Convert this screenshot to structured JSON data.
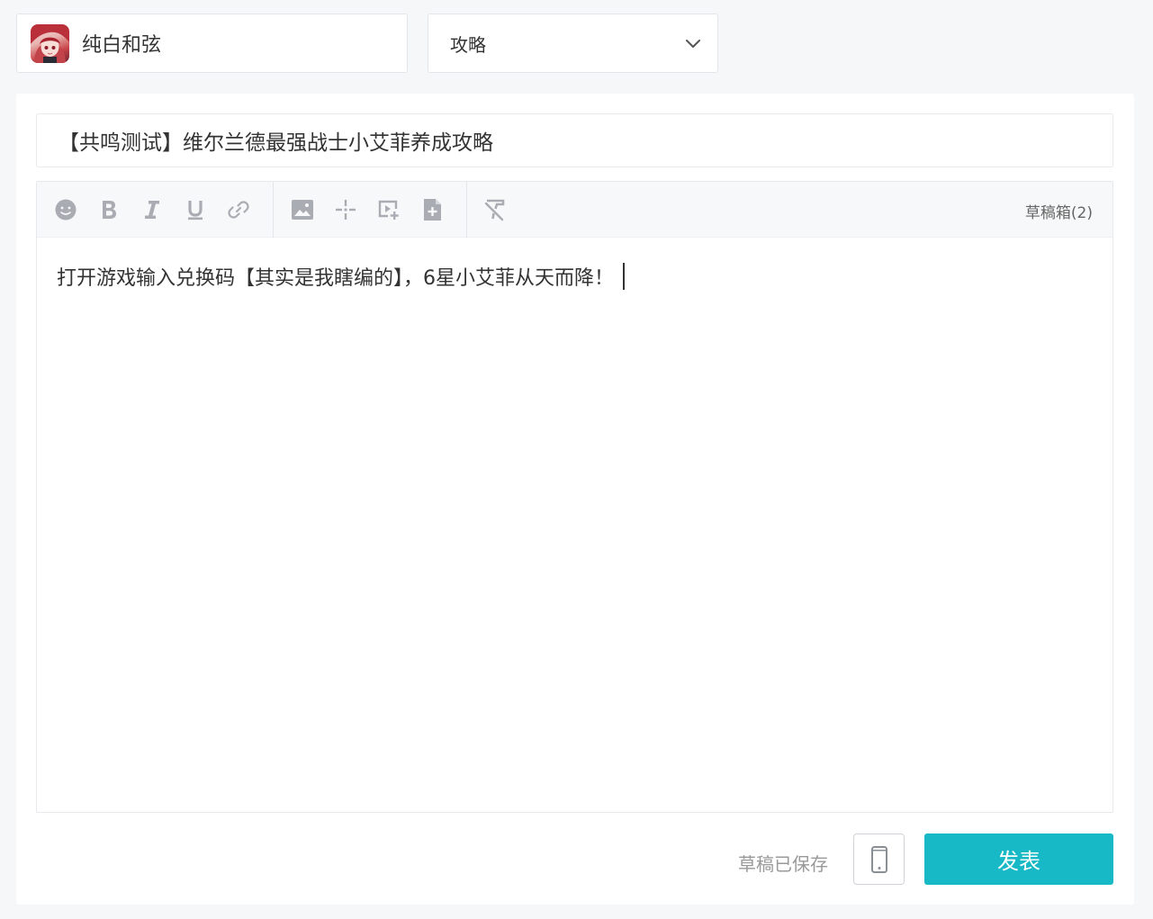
{
  "header": {
    "game": {
      "name": "纯白和弦",
      "avatar_icon": "game-avatar"
    },
    "category": {
      "selected": "攻略"
    }
  },
  "post": {
    "title": "【共鸣测试】维尔兰德最强战士小艾菲养成攻略",
    "body": "打开游戏输入兑换码【其实是我瞎编的】，6星小艾菲从天而降！"
  },
  "toolbar": {
    "tools": [
      "emoji-icon",
      "bold-icon",
      "italic-icon",
      "underline-icon",
      "link-icon",
      "image-icon",
      "sparkle-icon",
      "video-icon",
      "attachment-icon",
      "clear-format-icon"
    ],
    "drafts_label": "草稿箱(2)"
  },
  "footer": {
    "status": "草稿已保存",
    "preview_icon": "mobile-phone-icon",
    "publish_label": "发表"
  },
  "colors": {
    "accent": "#17b9c6",
    "icon": "#a9adb3",
    "background": "#f6f7f9"
  }
}
